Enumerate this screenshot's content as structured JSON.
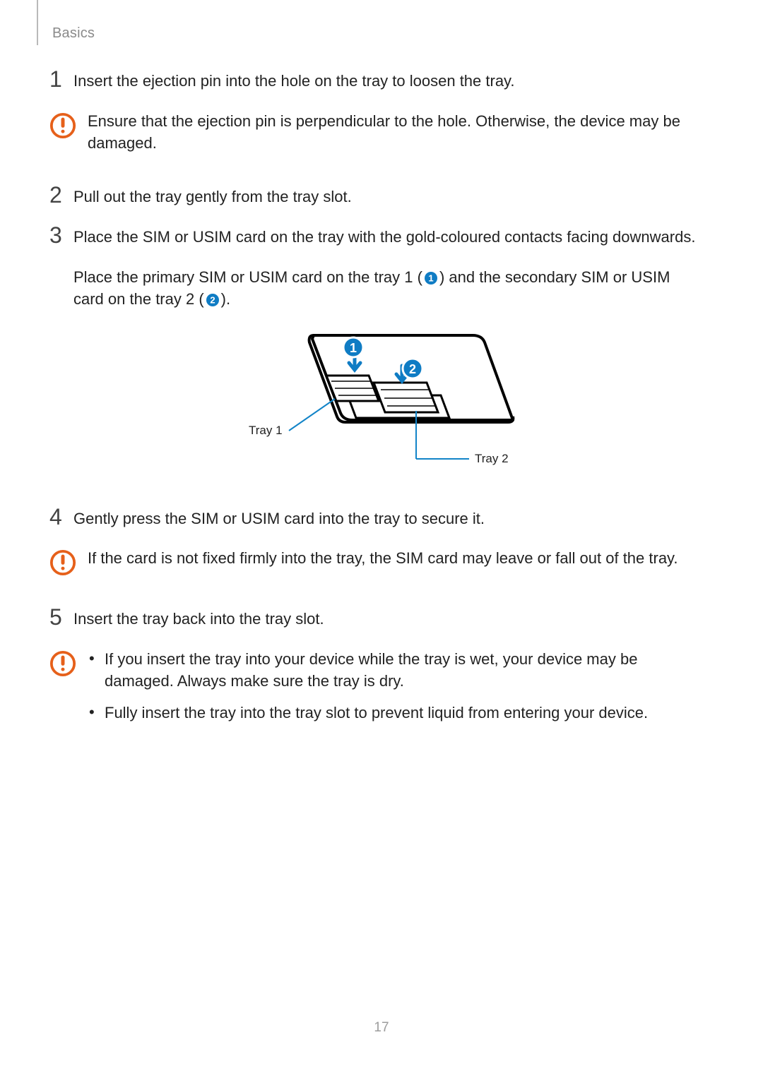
{
  "section": "Basics",
  "pageNumber": "17",
  "steps": {
    "s1": {
      "num": "1",
      "text": "Insert the ejection pin into the hole on the tray to loosen the tray."
    },
    "s2": {
      "num": "2",
      "text": "Pull out the tray gently from the tray slot."
    },
    "s3": {
      "num": "3",
      "text": "Place the SIM or USIM card on the tray with the gold-coloured contacts facing downwards."
    },
    "s3b_pre": "Place the primary SIM or USIM card on the tray 1 (",
    "s3b_mid": ") and the secondary SIM or USIM card on the tray 2 (",
    "s3b_post": ").",
    "s4": {
      "num": "4",
      "text": "Gently press the SIM or USIM card into the tray to secure it."
    },
    "s5": {
      "num": "5",
      "text": "Insert the tray back into the tray slot."
    }
  },
  "cautions": {
    "c1": "Ensure that the ejection pin is perpendicular to the hole. Otherwise, the device may be damaged.",
    "c2": "If the card is not fixed firmly into the tray, the SIM card may leave or fall out of the tray.",
    "c3a": "If you insert the tray into your device while the tray is wet, your device may be damaged. Always make sure the tray is dry.",
    "c3b": "Fully insert the tray into the tray slot to prevent liquid from entering your device."
  },
  "figure": {
    "tray1": "Tray 1",
    "tray2": "Tray 2",
    "badge1": "1",
    "badge2": "2"
  },
  "colors": {
    "caution": "#e6601a",
    "badge": "#0f7cc4",
    "leader": "#1284c8"
  }
}
